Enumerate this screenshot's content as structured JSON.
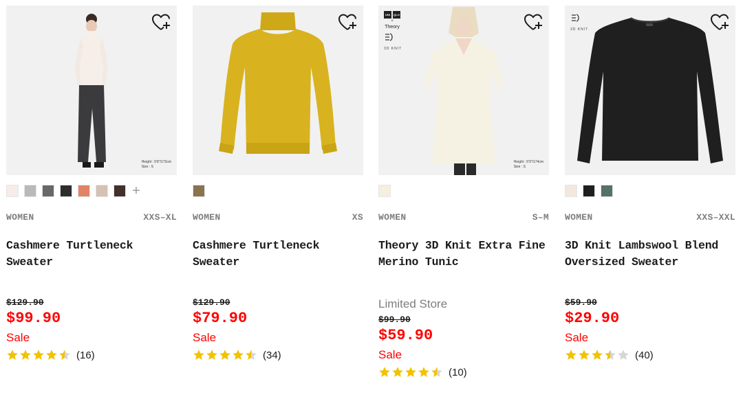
{
  "products": [
    {
      "model_note": [
        "Height : 5'8\"/173cm",
        "Size : S"
      ],
      "colors": [
        "#f7ece9",
        "#b9b9b9",
        "#6a6866",
        "#2d2d2d",
        "#e18466",
        "#d4c2b2",
        "#43302c"
      ],
      "more_colors": "+",
      "gender": "WOMEN",
      "sizes": "XXS–XL",
      "name": "Cashmere Turtleneck Sweater",
      "limited": "",
      "original_price": "$129.90",
      "price": "$99.90",
      "sale_label": "Sale",
      "rating": 4.5,
      "review_count": "(16)"
    },
    {
      "model_note": [],
      "colors": [
        "#8a7350"
      ],
      "more_colors": "",
      "gender": "WOMEN",
      "sizes": "XS",
      "name": "Cashmere Turtleneck Sweater",
      "limited": "",
      "original_price": "$129.90",
      "price": "$79.90",
      "sale_label": "Sale",
      "rating": 4.5,
      "review_count": "(34)"
    },
    {
      "model_note": [
        "Height : 5'9\"/174cm",
        "Size : S"
      ],
      "brand_logo": [
        "UNI",
        "QLO"
      ],
      "collab_x": "×",
      "collab_brand": "Theory",
      "knit_label": "3D KNIT",
      "colors": [
        "#f4efdf"
      ],
      "more_colors": "",
      "gender": "WOMEN",
      "sizes": "S–M",
      "name": "Theory 3D Knit Extra Fine Merino Tunic",
      "limited": "Limited Store",
      "original_price": "$99.90",
      "price": "$59.90",
      "sale_label": "Sale",
      "rating": 4.5,
      "review_count": "(10)"
    },
    {
      "model_note": [],
      "knit_label": "3D KNIT",
      "colors": [
        "#f2e8dd",
        "#1f1f1f",
        "#56706a"
      ],
      "more_colors": "",
      "gender": "WOMEN",
      "sizes": "XXS–XXL",
      "name": "3D Knit Lambswool Blend Oversized Sweater",
      "limited": "",
      "original_price": "$59.90",
      "price": "$29.90",
      "sale_label": "Sale",
      "rating": 3.5,
      "review_count": "(40)"
    }
  ],
  "theme": {
    "sale_color": "#ff0000",
    "star_color": "#f2c200",
    "star_empty": "#d6d6d6"
  },
  "icons": {
    "favorite": "heart-plus-icon",
    "star": "star-icon"
  }
}
